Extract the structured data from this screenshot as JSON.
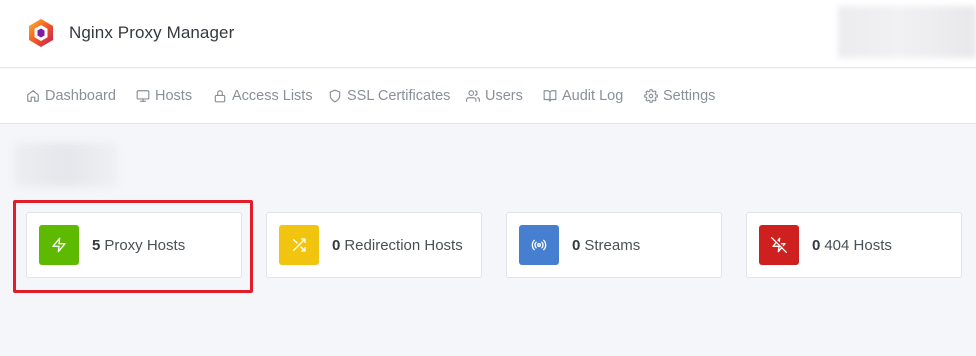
{
  "app": {
    "title": "Nginx Proxy Manager"
  },
  "nav": {
    "items": [
      {
        "label": "Dashboard",
        "icon": "home-icon"
      },
      {
        "label": "Hosts",
        "icon": "monitor-icon"
      },
      {
        "label": "Access Lists",
        "icon": "lock-icon"
      },
      {
        "label": "SSL Certificates",
        "icon": "shield-icon"
      },
      {
        "label": "Users",
        "icon": "users-icon"
      },
      {
        "label": "Audit Log",
        "icon": "book-icon"
      },
      {
        "label": "Settings",
        "icon": "gear-icon"
      }
    ]
  },
  "stats": [
    {
      "count": "5",
      "label": "Proxy Hosts",
      "icon": "zap-icon",
      "color": "#5eba00"
    },
    {
      "count": "0",
      "label": "Redirection Hosts",
      "icon": "shuffle-icon",
      "color": "#f1c40f"
    },
    {
      "count": "0",
      "label": "Streams",
      "icon": "radio-icon",
      "color": "#467fcf"
    },
    {
      "count": "0",
      "label": "404 Hosts",
      "icon": "zap-off-icon",
      "color": "#cd201f"
    }
  ],
  "colors": {
    "highlight": "#e11d2b",
    "nav_text": "#8a9099"
  }
}
